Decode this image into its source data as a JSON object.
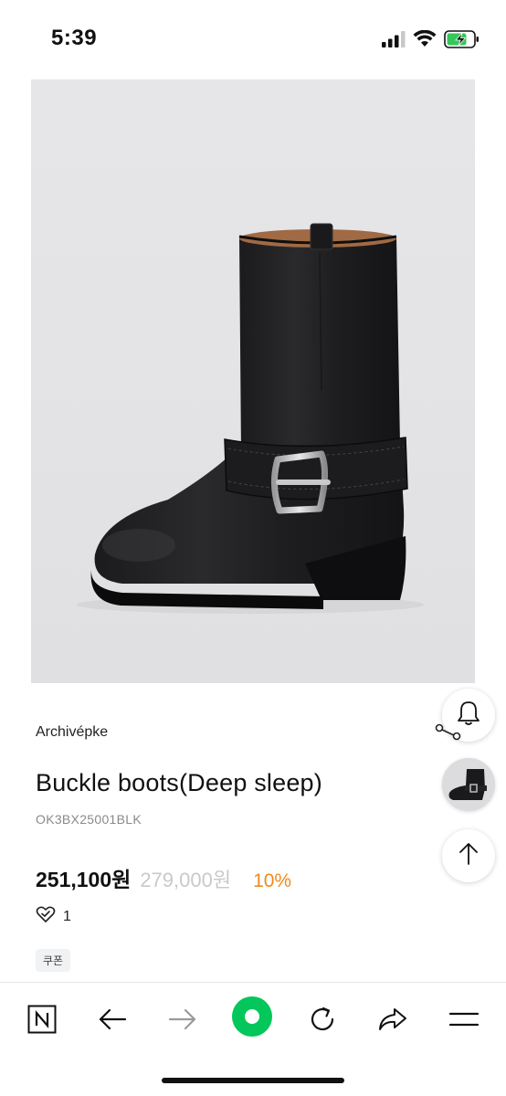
{
  "status": {
    "time": "5:39"
  },
  "product": {
    "brand": "Archivépke",
    "title": "Buckle boots(Deep sleep)",
    "sku": "OK3BX25001BLK",
    "price": "251,100원",
    "original_price": "279,000원",
    "discount": "10%",
    "likes": "1",
    "coupon_label": "쿠폰"
  },
  "floating": {
    "alarm_icon": "bell-icon",
    "share_icon": "share-icon",
    "top_icon": "arrow-up-icon"
  },
  "bottom_bar": {
    "items": [
      "naver-n-icon",
      "back-arrow-icon",
      "forward-arrow-icon",
      "green-dot-icon",
      "refresh-icon",
      "share-icon",
      "menu-icon"
    ]
  },
  "colors": {
    "discount": "#f08a1c",
    "green_button": "#03c75a",
    "battery": "#34c759"
  }
}
